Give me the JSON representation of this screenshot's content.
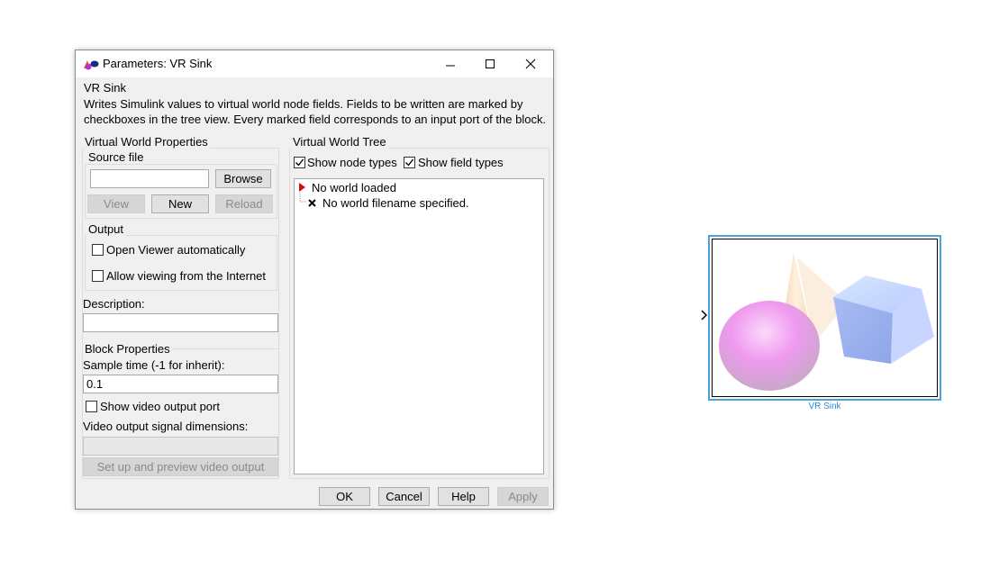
{
  "dialog": {
    "title": "Parameters: VR Sink",
    "heading": "VR Sink",
    "description": "Writes Simulink values to virtual world node fields. Fields to be written are marked by checkboxes in the tree view. Every marked field corresponds to an input port of the block."
  },
  "virtual_world_properties": {
    "title": "Virtual World Properties",
    "source_file": {
      "label": "Source file",
      "value": "",
      "browse_label": "Browse"
    },
    "buttons": {
      "view_label": "View",
      "new_label": "New",
      "reload_label": "Reload"
    },
    "output": {
      "title": "Output",
      "open_viewer_label": "Open Viewer automatically",
      "open_viewer_checked": false,
      "allow_internet_label": "Allow viewing from the Internet",
      "allow_internet_checked": false
    },
    "description": {
      "label": "Description:",
      "value": ""
    }
  },
  "block_properties": {
    "title": "Block Properties",
    "sample_time_label": "Sample time (-1 for inherit):",
    "sample_time_value": "0.1",
    "show_video_label": "Show video output port",
    "show_video_checked": false,
    "video_dims_label": "Video output signal dimensions:",
    "video_dims_value": "",
    "setup_video_label": "Set up and preview video output"
  },
  "virtual_world_tree": {
    "title": "Virtual World Tree",
    "show_node_types_label": "Show node types",
    "show_node_types_checked": true,
    "show_field_types_label": "Show field types",
    "show_field_types_checked": true,
    "items": [
      {
        "text": "No world loaded",
        "icon": "red-triangle-icon"
      },
      {
        "text": "No world filename specified.",
        "icon": "x-mark-icon"
      }
    ]
  },
  "footer": {
    "ok_label": "OK",
    "cancel_label": "Cancel",
    "help_label": "Help",
    "apply_label": "Apply"
  },
  "block": {
    "label": "VR Sink",
    "border_color": "#4aa3df",
    "label_color": "#2a8ad4"
  }
}
